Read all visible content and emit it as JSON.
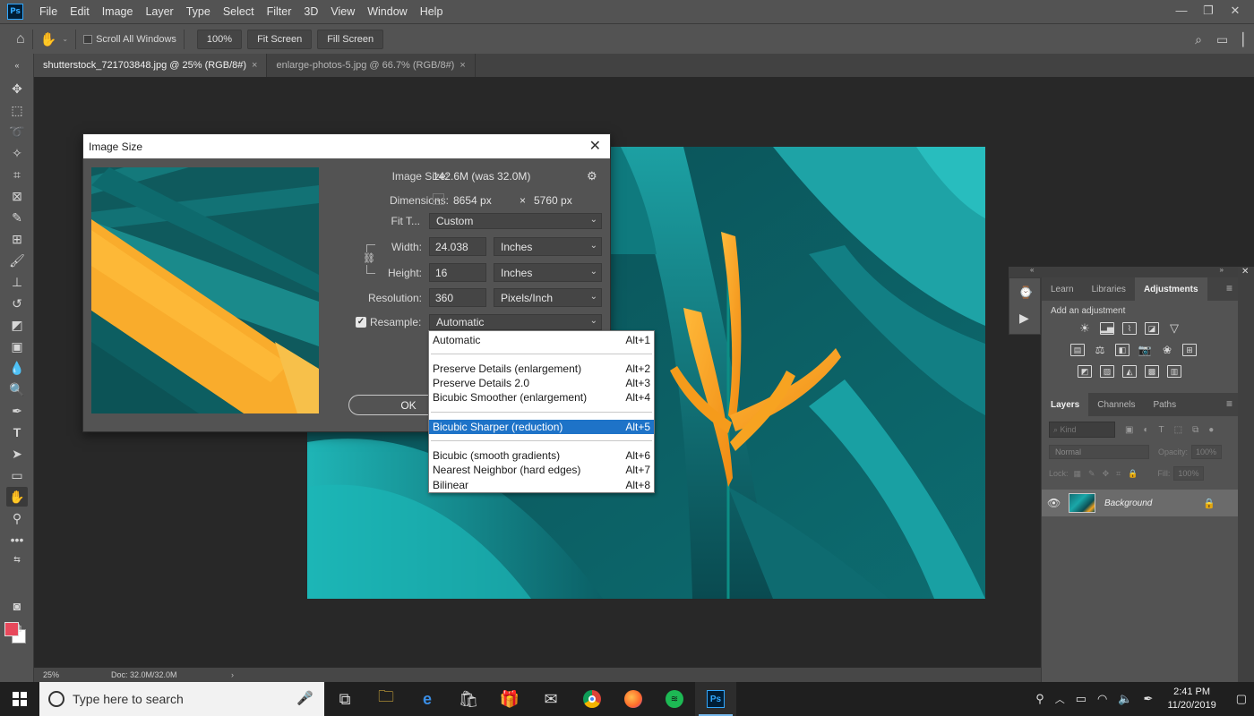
{
  "app": {
    "logo_text": "Ps",
    "menu": [
      "File",
      "Edit",
      "Image",
      "Layer",
      "Type",
      "Select",
      "Filter",
      "3D",
      "View",
      "Window",
      "Help"
    ]
  },
  "options_bar": {
    "scroll_all_label": "Scroll All Windows",
    "zoom_value": "100%",
    "fit_screen_label": "Fit Screen",
    "fill_screen_label": "Fill Screen"
  },
  "doc_tabs": [
    {
      "label": "shutterstock_721703848.jpg @ 25% (RGB/8#)",
      "active": true
    },
    {
      "label": "enlarge-photos-5.jpg @ 66.7% (RGB/8#)",
      "active": false
    }
  ],
  "status_bar": {
    "zoom": "25%",
    "doc_info": "Doc: 32.0M/32.0M"
  },
  "dialog": {
    "title": "Image Size",
    "image_size_label": "Image Size:",
    "image_size_value": "142.6M (was 32.0M)",
    "dimensions_label": "Dimensions:",
    "dimensions_w": "8654 px",
    "dimensions_x": "×",
    "dimensions_h": "5760 px",
    "fit_label": "Fit T...",
    "fit_value": "Custom",
    "width_label": "Width:",
    "width_value": "24.038",
    "width_unit": "Inches",
    "height_label": "Height:",
    "height_value": "16",
    "height_unit": "Inches",
    "resolution_label": "Resolution:",
    "resolution_value": "360",
    "resolution_unit": "Pixels/Inch",
    "resample_label": "Resample:",
    "resample_value": "Automatic",
    "resample_checked": true,
    "ok_label": "OK"
  },
  "resample_options": [
    {
      "label": "Automatic",
      "shortcut": "Alt+1",
      "selected": false
    },
    {
      "label": "Preserve Details (enlargement)",
      "shortcut": "Alt+2",
      "selected": false
    },
    {
      "label": "Preserve Details 2.0",
      "shortcut": "Alt+3",
      "selected": false
    },
    {
      "label": "Bicubic Smoother (enlargement)",
      "shortcut": "Alt+4",
      "selected": false
    },
    {
      "label": "Bicubic Sharper (reduction)",
      "shortcut": "Alt+5",
      "selected": true
    },
    {
      "label": "Bicubic (smooth gradients)",
      "shortcut": "Alt+6",
      "selected": false
    },
    {
      "label": "Nearest Neighbor (hard edges)",
      "shortcut": "Alt+7",
      "selected": false
    },
    {
      "label": "Bilinear",
      "shortcut": "Alt+8",
      "selected": false
    }
  ],
  "panels": {
    "top_tabs": [
      "Learn",
      "Libraries",
      "Adjustments"
    ],
    "active_top_tab": "Adjustments",
    "adjustments_title": "Add an adjustment",
    "layer_tabs": [
      "Layers",
      "Channels",
      "Paths"
    ],
    "active_layer_tab": "Layers",
    "kind_placeholder": "Kind",
    "blend_mode": "Normal",
    "opacity_label": "Opacity:",
    "opacity_value": "100%",
    "lock_label": "Lock:",
    "fill_label": "Fill:",
    "fill_value": "100%",
    "layer_name": "Background"
  },
  "taskbar": {
    "search_placeholder": "Type here to search",
    "time": "2:41 PM",
    "date": "11/20/2019"
  },
  "colors": {
    "foreground": "#e8495c",
    "background": "#ffffff",
    "selection": "#1e73c8",
    "accent_teal": "#1aa7a9",
    "flower_orange": "#f4a11d"
  }
}
